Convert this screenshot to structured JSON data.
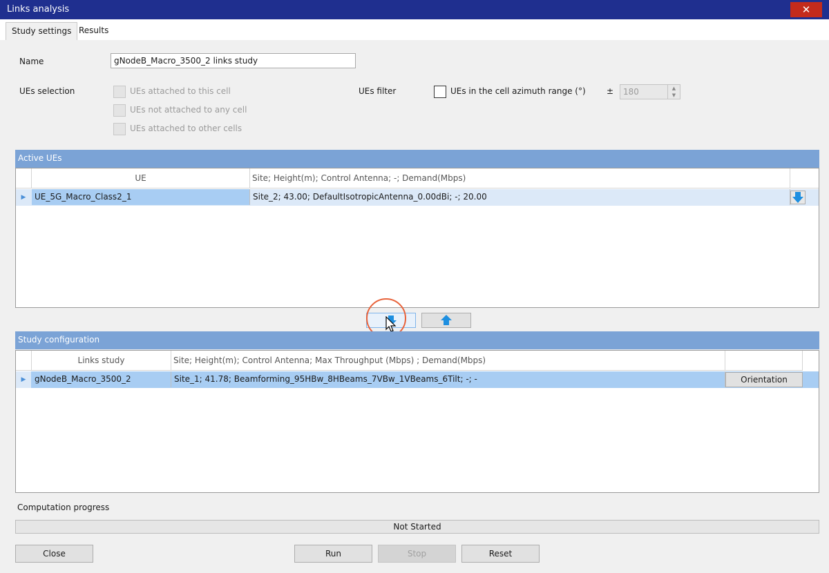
{
  "window": {
    "title": "Links analysis",
    "close_glyph": "✕"
  },
  "tabs": [
    {
      "label": "Study settings"
    },
    {
      "label": "Results"
    }
  ],
  "form": {
    "name_label": "Name",
    "name_value": "gNodeB_Macro_3500_2 links study",
    "ues_selection_label": "UEs selection",
    "ues_options": [
      "UEs attached to this cell",
      "UEs not attached to any cell",
      "UEs attached to other cells"
    ],
    "ues_filter_label": "UEs filter",
    "ues_filter_checkbox": "UEs in the cell azimuth range (°)",
    "plus_minus": "±",
    "azimuth_value": "180"
  },
  "active_ues": {
    "header": "Active UEs",
    "columns": [
      "UE",
      "Site; Height(m); Control Antenna; -; Demand(Mbps)"
    ],
    "rows": [
      {
        "ue": "UE_5G_Macro_Class2_1",
        "details": "Site_2; 43.00; DefaultIsotropicAntenna_0.00dBi; -; 20.00"
      }
    ]
  },
  "study_config": {
    "header": "Study configuration",
    "columns": [
      "Links study",
      "Site; Height(m); Control Antenna; Max Throughput (Mbps) ; Demand(Mbps)"
    ],
    "rows": [
      {
        "study": "gNodeB_Macro_3500_2",
        "details": "Site_1; 41.78; Beamforming_95HBw_8HBeams_7VBw_1VBeams_6Tilt; -; -",
        "action": "Orientation"
      }
    ]
  },
  "progress": {
    "label": "Computation progress",
    "status": "Not Started"
  },
  "buttons": {
    "close": "Close",
    "run": "Run",
    "stop": "Stop",
    "reset": "Reset"
  },
  "colors": {
    "titlebar": "#1f2f8f",
    "section_header": "#7ba3d6",
    "arrow": "#1e8fe0",
    "highlight": "#e8623a"
  },
  "icons": {
    "move_down": "arrow-down-icon",
    "move_up": "arrow-up-icon",
    "cursor": "mouse-pointer-icon"
  }
}
